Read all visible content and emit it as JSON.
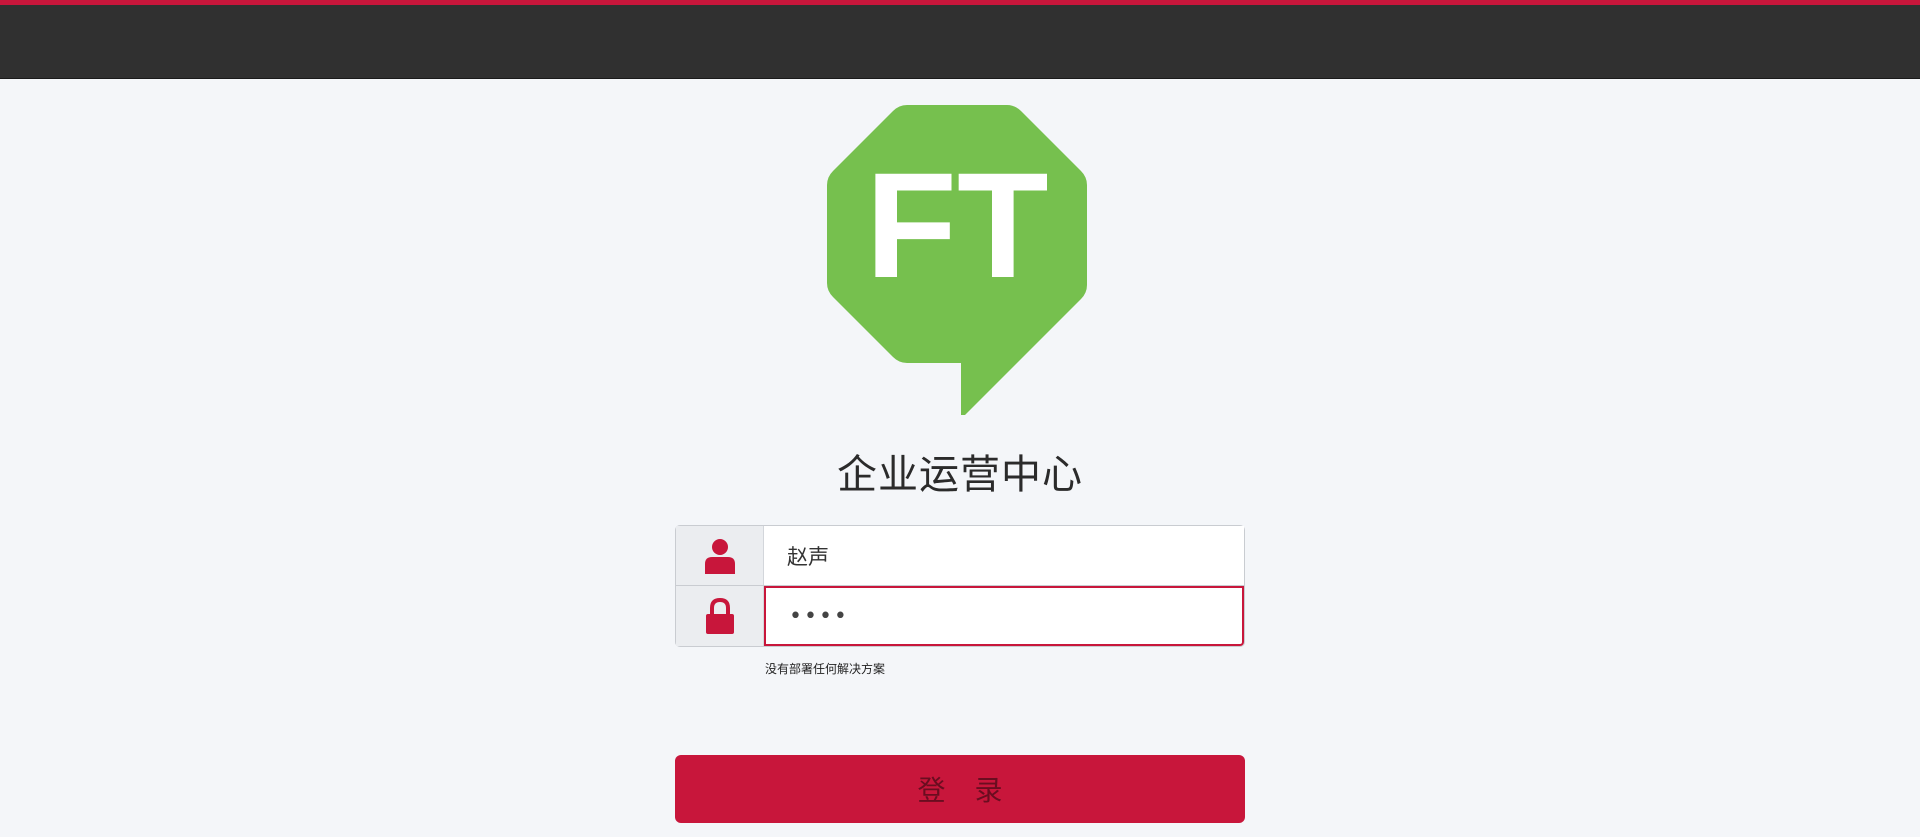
{
  "colors": {
    "accent": "#c8163b",
    "topbar": "#303030",
    "background": "#f4f6f9",
    "logo_green": "#76c04e"
  },
  "logo": {
    "text": "FT",
    "icon": "ft-speech-bubble-logo"
  },
  "app": {
    "title": "企业运营中心"
  },
  "form": {
    "username": {
      "icon": "user-icon",
      "value": "赵声"
    },
    "password": {
      "icon": "lock-icon",
      "value": "••••"
    },
    "status_message": "没有部署任何解决方案",
    "login_label": "登 录"
  }
}
